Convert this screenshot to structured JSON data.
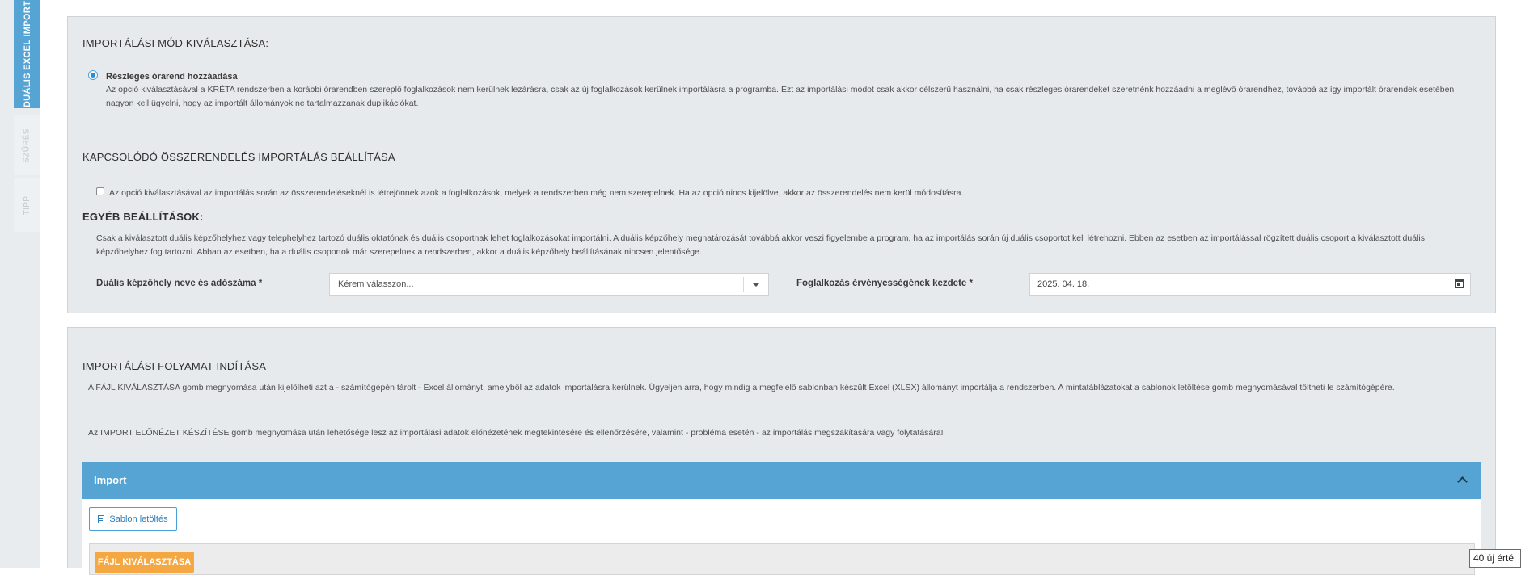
{
  "tabs": {
    "active": "DUÁLIS EXCEL IMPORT",
    "szures": "SZŰRÉS",
    "tipp": "TIPP"
  },
  "section1": {
    "title": "IMPORTÁLÁSI MÓD KIVÁLASZTÁSA:",
    "radio_label": "Részleges órarend hozzáadása",
    "radio_desc": "Az opció kiválasztásával a KRÉTA rendszerben a korábbi órarendben szereplő foglalkozások nem kerülnek lezárásra, csak az új foglalkozások kerülnek importálásra a programba. Ezt az importálási módot csak akkor célszerű használni, ha csak részleges órarendeket szeretnénk hozzáadni a meglévő órarendhez, továbbá az így importált órarendek esetében nagyon kell ügyelni, hogy az importált állományok ne tartalmazzanak duplikációkat."
  },
  "section2": {
    "title": "KAPCSOLÓDÓ ÖSSZERENDELÉS IMPORTÁLÁS BEÁLLÍTÁSA",
    "checkbox_label": "Az opció kiválasztásával az importálás során az összerendeléseknél is létrejönnek azok a foglalkozások, melyek a rendszerben még nem szerepelnek. Ha az opció nincs kijelölve, akkor az összerendelés nem kerül módosításra."
  },
  "section3": {
    "title": "EGYÉB BEÁLLÍTÁSOK:",
    "desc": "Csak a kiválasztott duális képzőhelyhez vagy telephelyhez tartozó duális oktatónak és duális csoportnak lehet foglalkozásokat importálni. A duális képzőhely meghatározását továbbá akkor veszi figyelembe a program, ha az importálás során új duális csoportot kell létrehozni. Ebben az esetben az importálással rögzített duális csoport a kiválasztott duális képzőhelyhez fog tartozni. Abban az esetben, ha a duális csoportok már szerepelnek a rendszerben, akkor a duális képzőhely beállításának nincsen jelentősége.",
    "kepzohely_label": "Duális képzőhely neve és adószáma *",
    "kepzohely_placeholder": "Kérem válasszon...",
    "datum_label": "Foglalkozás érvényességének kezdete *",
    "datum_value": "2025. 04. 18."
  },
  "section4": {
    "title": "IMPORTÁLÁSI FOLYAMAT INDÍTÁSA",
    "desc1": "A FÁJL KIVÁLASZTÁSA gomb megnyomása után kijelölheti azt a - számítógépén tárolt - Excel állományt, amelyből az adatok importálásra kerülnek. Ügyeljen arra, hogy mindig a megfelelő sablonban készült Excel (XLSX) állományt importálja a rendszerben. A mintatáblázatokat a sablonok letöltése gomb megnyomásával töltheti le számítógépére.",
    "desc2": "Az IMPORT ELŐNÉZET KÉSZÍTÉSE gomb megnyomása után lehetősége lesz az importálási adatok előnézetének megtekintésére és ellenőrzésére, valamint - probléma esetén - az importálás megszakítására vagy folytatására!"
  },
  "import_panel": {
    "title": "Import",
    "sablon_button": "Sablon letöltés",
    "file_button": "FÁJL KIVÁLASZTÁSA"
  },
  "tooltip": "40 új érté"
}
